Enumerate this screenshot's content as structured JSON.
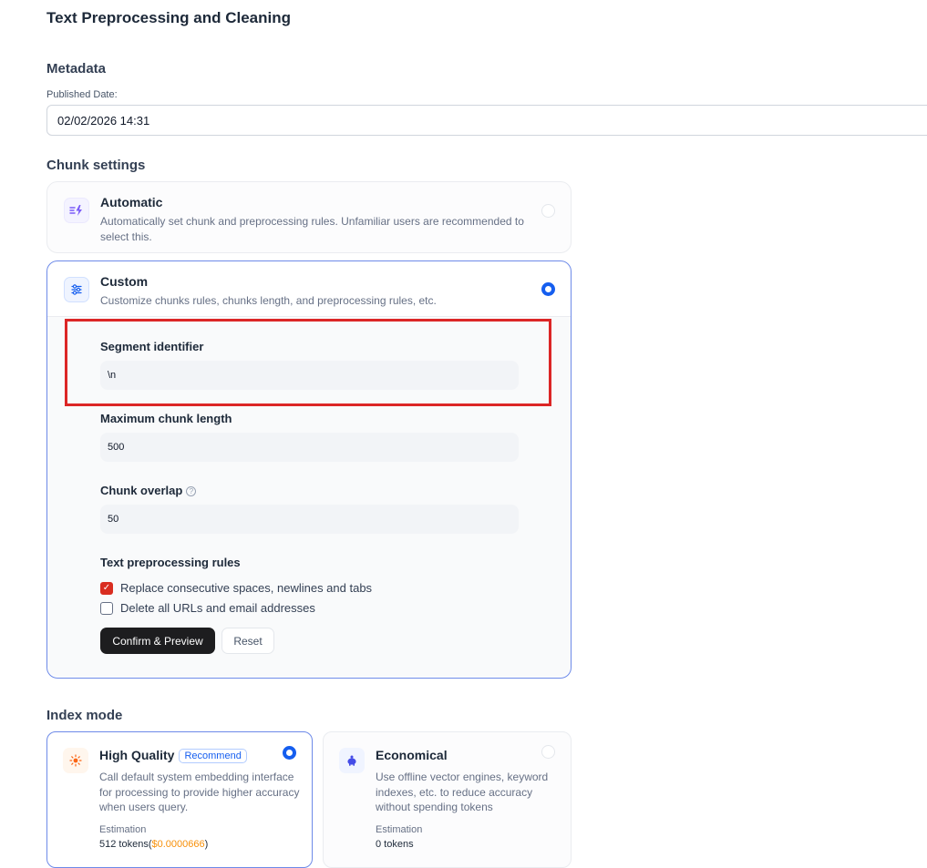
{
  "page": {
    "title": "Text Preprocessing and Cleaning"
  },
  "metadata": {
    "section_title": "Metadata",
    "published_label": "Published Date:",
    "published_value": "02/02/2026 14:31"
  },
  "chunk_settings": {
    "section_title": "Chunk settings",
    "automatic": {
      "title": "Automatic",
      "description": "Automatically set chunk and preprocessing rules. Unfamiliar users are recommended to select this.",
      "icon": "lightning-icon",
      "selected": false
    },
    "custom": {
      "title": "Custom",
      "description": "Customize chunks rules, chunks length, and preprocessing rules, etc.",
      "icon": "sliders-icon",
      "selected": true,
      "segment_identifier_label": "Segment identifier",
      "segment_identifier_value": "\\n",
      "max_chunk_label": "Maximum chunk length",
      "max_chunk_value": "500",
      "overlap_label": "Chunk overlap",
      "overlap_value": "50",
      "rules_label": "Text preprocessing rules",
      "rules": [
        {
          "label": "Replace consecutive spaces, newlines and tabs",
          "checked": true
        },
        {
          "label": "Delete all URLs and email addresses",
          "checked": false
        }
      ],
      "confirm_label": "Confirm & Preview",
      "reset_label": "Reset"
    }
  },
  "index_mode": {
    "section_title": "Index mode",
    "high_quality": {
      "title": "High Quality",
      "badge": "Recommend",
      "description": "Call default system embedding interface for processing to provide higher accuracy when users query.",
      "estimation_label": "Estimation",
      "estimation_tokens": "512 tokens(",
      "estimation_cost": "$0.0000666",
      "estimation_close": ")",
      "selected": true
    },
    "economical": {
      "title": "Economical",
      "description": "Use offline vector engines, keyword indexes, etc. to reduce accuracy without spending tokens",
      "estimation_label": "Estimation",
      "estimation_tokens": "0 tokens",
      "selected": false
    }
  },
  "colors": {
    "accent": "#155eef",
    "highlight": "#dc2626",
    "checkbox": "#d92d20",
    "cost": "#f79009"
  }
}
